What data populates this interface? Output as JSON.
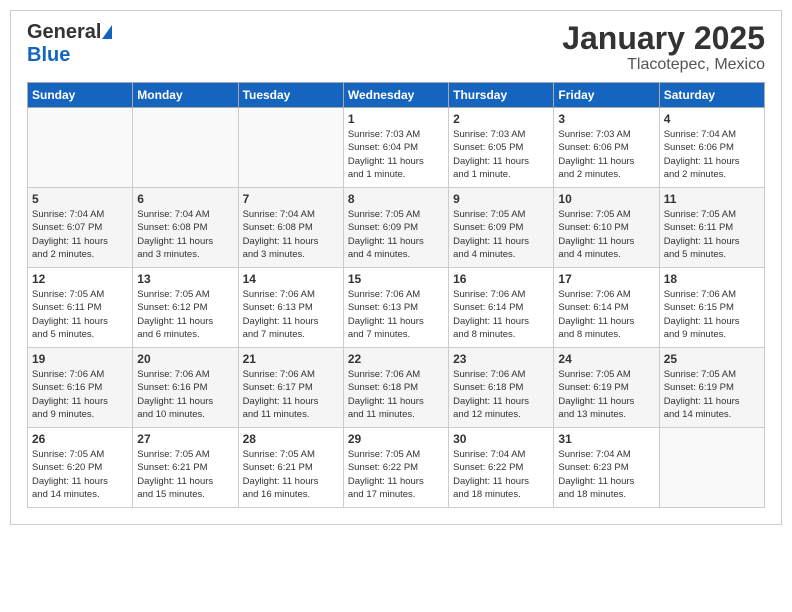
{
  "header": {
    "logo_general": "General",
    "logo_blue": "Blue",
    "month": "January 2025",
    "location": "Tlacotepec, Mexico"
  },
  "weekdays": [
    "Sunday",
    "Monday",
    "Tuesday",
    "Wednesday",
    "Thursday",
    "Friday",
    "Saturday"
  ],
  "weeks": [
    [
      {
        "day": "",
        "info": ""
      },
      {
        "day": "",
        "info": ""
      },
      {
        "day": "",
        "info": ""
      },
      {
        "day": "1",
        "info": "Sunrise: 7:03 AM\nSunset: 6:04 PM\nDaylight: 11 hours\nand 1 minute."
      },
      {
        "day": "2",
        "info": "Sunrise: 7:03 AM\nSunset: 6:05 PM\nDaylight: 11 hours\nand 1 minute."
      },
      {
        "day": "3",
        "info": "Sunrise: 7:03 AM\nSunset: 6:06 PM\nDaylight: 11 hours\nand 2 minutes."
      },
      {
        "day": "4",
        "info": "Sunrise: 7:04 AM\nSunset: 6:06 PM\nDaylight: 11 hours\nand 2 minutes."
      }
    ],
    [
      {
        "day": "5",
        "info": "Sunrise: 7:04 AM\nSunset: 6:07 PM\nDaylight: 11 hours\nand 2 minutes."
      },
      {
        "day": "6",
        "info": "Sunrise: 7:04 AM\nSunset: 6:08 PM\nDaylight: 11 hours\nand 3 minutes."
      },
      {
        "day": "7",
        "info": "Sunrise: 7:04 AM\nSunset: 6:08 PM\nDaylight: 11 hours\nand 3 minutes."
      },
      {
        "day": "8",
        "info": "Sunrise: 7:05 AM\nSunset: 6:09 PM\nDaylight: 11 hours\nand 4 minutes."
      },
      {
        "day": "9",
        "info": "Sunrise: 7:05 AM\nSunset: 6:09 PM\nDaylight: 11 hours\nand 4 minutes."
      },
      {
        "day": "10",
        "info": "Sunrise: 7:05 AM\nSunset: 6:10 PM\nDaylight: 11 hours\nand 4 minutes."
      },
      {
        "day": "11",
        "info": "Sunrise: 7:05 AM\nSunset: 6:11 PM\nDaylight: 11 hours\nand 5 minutes."
      }
    ],
    [
      {
        "day": "12",
        "info": "Sunrise: 7:05 AM\nSunset: 6:11 PM\nDaylight: 11 hours\nand 5 minutes."
      },
      {
        "day": "13",
        "info": "Sunrise: 7:05 AM\nSunset: 6:12 PM\nDaylight: 11 hours\nand 6 minutes."
      },
      {
        "day": "14",
        "info": "Sunrise: 7:06 AM\nSunset: 6:13 PM\nDaylight: 11 hours\nand 7 minutes."
      },
      {
        "day": "15",
        "info": "Sunrise: 7:06 AM\nSunset: 6:13 PM\nDaylight: 11 hours\nand 7 minutes."
      },
      {
        "day": "16",
        "info": "Sunrise: 7:06 AM\nSunset: 6:14 PM\nDaylight: 11 hours\nand 8 minutes."
      },
      {
        "day": "17",
        "info": "Sunrise: 7:06 AM\nSunset: 6:14 PM\nDaylight: 11 hours\nand 8 minutes."
      },
      {
        "day": "18",
        "info": "Sunrise: 7:06 AM\nSunset: 6:15 PM\nDaylight: 11 hours\nand 9 minutes."
      }
    ],
    [
      {
        "day": "19",
        "info": "Sunrise: 7:06 AM\nSunset: 6:16 PM\nDaylight: 11 hours\nand 9 minutes."
      },
      {
        "day": "20",
        "info": "Sunrise: 7:06 AM\nSunset: 6:16 PM\nDaylight: 11 hours\nand 10 minutes."
      },
      {
        "day": "21",
        "info": "Sunrise: 7:06 AM\nSunset: 6:17 PM\nDaylight: 11 hours\nand 11 minutes."
      },
      {
        "day": "22",
        "info": "Sunrise: 7:06 AM\nSunset: 6:18 PM\nDaylight: 11 hours\nand 11 minutes."
      },
      {
        "day": "23",
        "info": "Sunrise: 7:06 AM\nSunset: 6:18 PM\nDaylight: 11 hours\nand 12 minutes."
      },
      {
        "day": "24",
        "info": "Sunrise: 7:05 AM\nSunset: 6:19 PM\nDaylight: 11 hours\nand 13 minutes."
      },
      {
        "day": "25",
        "info": "Sunrise: 7:05 AM\nSunset: 6:19 PM\nDaylight: 11 hours\nand 14 minutes."
      }
    ],
    [
      {
        "day": "26",
        "info": "Sunrise: 7:05 AM\nSunset: 6:20 PM\nDaylight: 11 hours\nand 14 minutes."
      },
      {
        "day": "27",
        "info": "Sunrise: 7:05 AM\nSunset: 6:21 PM\nDaylight: 11 hours\nand 15 minutes."
      },
      {
        "day": "28",
        "info": "Sunrise: 7:05 AM\nSunset: 6:21 PM\nDaylight: 11 hours\nand 16 minutes."
      },
      {
        "day": "29",
        "info": "Sunrise: 7:05 AM\nSunset: 6:22 PM\nDaylight: 11 hours\nand 17 minutes."
      },
      {
        "day": "30",
        "info": "Sunrise: 7:04 AM\nSunset: 6:22 PM\nDaylight: 11 hours\nand 18 minutes."
      },
      {
        "day": "31",
        "info": "Sunrise: 7:04 AM\nSunset: 6:23 PM\nDaylight: 11 hours\nand 18 minutes."
      },
      {
        "day": "",
        "info": ""
      }
    ]
  ]
}
